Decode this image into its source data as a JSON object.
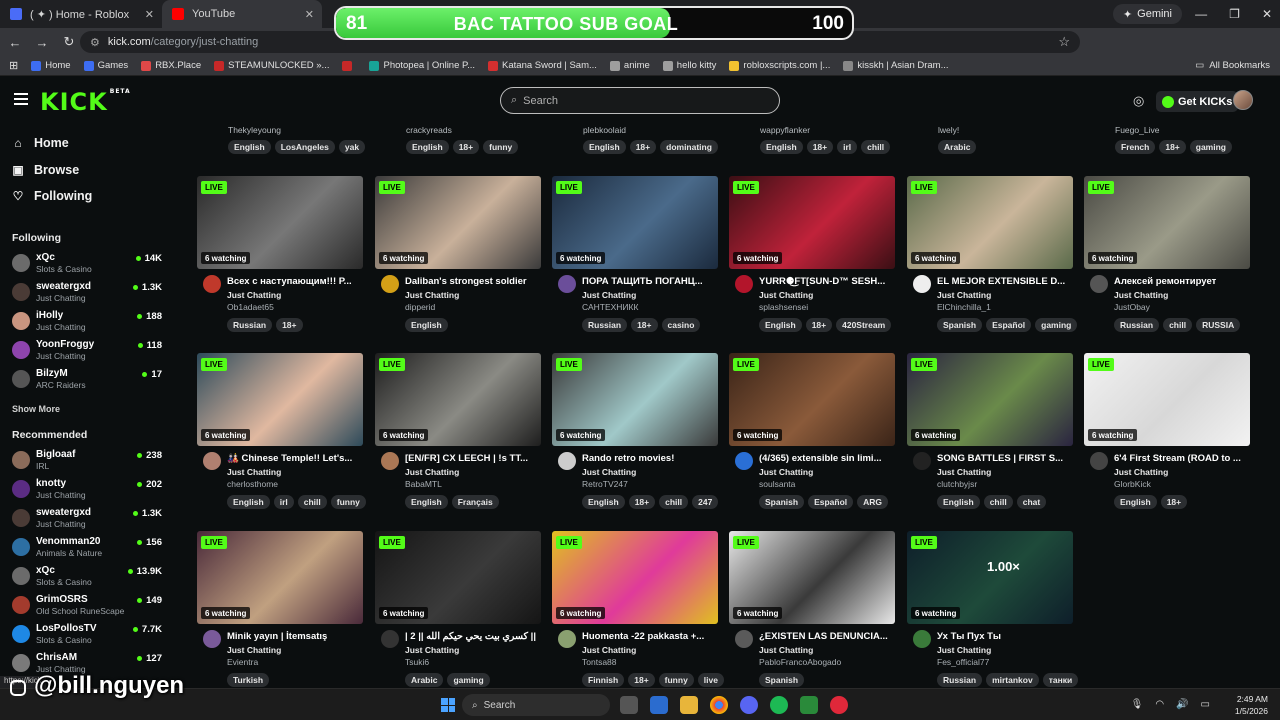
{
  "browser": {
    "tabs": [
      {
        "label": "( ✦ ) Home - Roblox",
        "favicon": "roblox-icon",
        "color": "#4a6cf7"
      },
      {
        "label": "YouTube",
        "favicon": "youtube-icon",
        "color": "#ff0000"
      }
    ],
    "gemini_label": "Gemini",
    "url_host": "kick.com",
    "url_path": "/category/just-chatting",
    "bookmarks": [
      {
        "label": "Home",
        "color": "#3d6df2"
      },
      {
        "label": "Games",
        "color": "#3d6df2"
      },
      {
        "label": "RBX.Place",
        "color": "#e04848"
      },
      {
        "label": "STEAMUNLOCKED »...",
        "color": "#c62828"
      },
      {
        "label": "",
        "color": "#c62828"
      },
      {
        "label": "Photopea | Online P...",
        "color": "#18a497"
      },
      {
        "label": "Katana Sword | Sam...",
        "color": "#d32f2f"
      },
      {
        "label": "anime",
        "color": "#9e9e9e"
      },
      {
        "label": "hello kitty",
        "color": "#9e9e9e"
      },
      {
        "label": "robloxscripts.com |...",
        "color": "#f2c230"
      },
      {
        "label": "kisskh | Asian Dram...",
        "color": "#888888"
      }
    ],
    "all_bookmarks": "All Bookmarks"
  },
  "goal": {
    "current": "81",
    "title": "BAC TATTOO SUB GOAL",
    "target": "100",
    "progress": 0.81
  },
  "header": {
    "logo": "KICK",
    "logo_badge": "BETA",
    "search_placeholder": "Search",
    "get_kicks": "Get KICKs"
  },
  "sidebar": {
    "nav": [
      {
        "label": "Home",
        "icon": "home-icon"
      },
      {
        "label": "Browse",
        "icon": "browse-icon"
      },
      {
        "label": "Following",
        "icon": "heart-icon"
      }
    ],
    "following_title": "Following",
    "following": [
      {
        "name": "xQc",
        "category": "Slots & Casino",
        "viewers": "14K",
        "color": "#6b6b6b"
      },
      {
        "name": "sweatergxd",
        "category": "Just Chatting",
        "viewers": "1.3K",
        "color": "#4a3b36"
      },
      {
        "name": "iHolly",
        "category": "Just Chatting",
        "viewers": "188",
        "color": "#c99580"
      },
      {
        "name": "YoonFroggy",
        "category": "Just Chatting",
        "viewers": "118",
        "color": "#8e44ad"
      },
      {
        "name": "BilzyM",
        "category": "ARC Raiders",
        "viewers": "17",
        "color": "#555555"
      }
    ],
    "show_more": "Show More",
    "recommended_title": "Recommended",
    "recommended": [
      {
        "name": "Bigloaaf",
        "category": "IRL",
        "viewers": "238",
        "color": "#8a6b5a"
      },
      {
        "name": "knotty",
        "category": "Just Chatting",
        "viewers": "202",
        "color": "#5b2c83"
      },
      {
        "name": "sweatergxd",
        "category": "Just Chatting",
        "viewers": "1.3K",
        "color": "#4a3b36"
      },
      {
        "name": "Venomman20",
        "category": "Animals & Nature",
        "viewers": "156",
        "color": "#2d6fa3"
      },
      {
        "name": "xQc",
        "category": "Slots & Casino",
        "viewers": "13.9K",
        "color": "#6b6b6b"
      },
      {
        "name": "GrimOSRS",
        "category": "Old School RuneScape",
        "viewers": "149",
        "color": "#a33b2d"
      },
      {
        "name": "LosPollosTV",
        "category": "Slots & Casino",
        "viewers": "7.7K",
        "color": "#1e88e5"
      },
      {
        "name": "ChrisAM",
        "category": "Just Chatting",
        "viewers": "127",
        "color": "#7a7a7a"
      }
    ]
  },
  "top_partial": [
    {
      "owner": "Thekyleyoung",
      "tags": [
        "English",
        "LosAngeles",
        "yak"
      ]
    },
    {
      "owner": "crackyreads",
      "tags": [
        "English",
        "18+",
        "funny"
      ]
    },
    {
      "owner": "plebkoolaid",
      "tags": [
        "English",
        "18+",
        "dominating"
      ]
    },
    {
      "owner": "wappyflanker",
      "tags": [
        "English",
        "18+",
        "irl",
        "chill"
      ]
    },
    {
      "owner": "lwely!",
      "tags": [
        "Arabic"
      ]
    },
    {
      "owner": "Fuego_Live",
      "tags": [
        "French",
        "18+",
        "gaming"
      ]
    }
  ],
  "cards": [
    {
      "title": "Всех с наступающим!!! Р...",
      "category": "Just Chatting",
      "owner": "Ob1adaet65",
      "watching": "6 watching",
      "tags": [
        "Russian",
        "18+"
      ],
      "thumb": "#2a2a2a",
      "thumb2": "#777777",
      "avatar": "#c0392b"
    },
    {
      "title": "Daliban's strongest soldier",
      "category": "Just Chatting",
      "owner": "dipperid",
      "watching": "6 watching",
      "tags": [
        "English"
      ],
      "thumb": "#3b3b3b",
      "thumb2": "#c8b09a",
      "avatar": "#d4a017"
    },
    {
      "title": "ПОРА ТАЩИТЬ ПОГАНЦ...",
      "category": "Just Chatting",
      "owner": "САНТЕХНИКК",
      "watching": "6 watching",
      "tags": [
        "Russian",
        "18+",
        "casino"
      ],
      "thumb": "#1b2a3d",
      "thumb2": "#4a6a8a",
      "avatar": "#6b4e9a"
    },
    {
      "title": "YURR⚈͜FT[SUN-D™ SESH...",
      "category": "Just Chatting",
      "owner": "splashsensei",
      "watching": "6 watching",
      "tags": [
        "English",
        "18+",
        "420Stream"
      ],
      "thumb": "#3a0f14",
      "thumb2": "#c0223a",
      "avatar": "#b3152b"
    },
    {
      "title": "EL MEJOR EXTENSIBLE D...",
      "category": "Just Chatting",
      "owner": "ElChinchilla_1",
      "watching": "6 watching",
      "tags": [
        "Spanish",
        "Español",
        "gaming"
      ],
      "thumb": "#5a6a4a",
      "thumb2": "#c9b59a",
      "avatar": "#eeeeee"
    },
    {
      "title": "Алексей ремонтирует",
      "category": "Just Chatting",
      "owner": "JustObay",
      "watching": "6 watching",
      "tags": [
        "Russian",
        "chill",
        "RUSSIA"
      ],
      "thumb": "#4a4a44",
      "thumb2": "#9a9a88",
      "avatar": "#555555"
    },
    {
      "title": "🎎 Chinese Temple!! Let's...",
      "category": "Just Chatting",
      "owner": "cherlosthome",
      "watching": "6 watching",
      "tags": [
        "English",
        "irl",
        "chill",
        "funny"
      ],
      "thumb": "#2d4a5a",
      "thumb2": "#e0b8a0",
      "avatar": "#b08070"
    },
    {
      "title": "[EN/FR] CX LEECH | !s TT...",
      "category": "Just Chatting",
      "owner": "BabaMTL",
      "watching": "6 watching",
      "tags": [
        "English",
        "Français"
      ],
      "thumb": "#1e1e1e",
      "thumb2": "#8a8a84",
      "avatar": "#aa7755"
    },
    {
      "title": "Rando retro movies!",
      "category": "Just Chatting",
      "owner": "RetroTV247",
      "watching": "6 watching",
      "tags": [
        "English",
        "18+",
        "chill",
        "247"
      ],
      "thumb": "#3a3a3a",
      "thumb2": "#a0c8c8",
      "avatar": "#cccccc"
    },
    {
      "title": "(4/365) extensible sin limi...",
      "category": "Just Chatting",
      "owner": "soulsanta",
      "watching": "6 watching",
      "tags": [
        "Spanish",
        "Español",
        "ARG"
      ],
      "thumb": "#3a2418",
      "thumb2": "#8a5a3a",
      "avatar": "#2a6fd6"
    },
    {
      "title": "SONG BATTLES | FIRST S...",
      "category": "Just Chatting",
      "owner": "clutchbyjsr",
      "watching": "6 watching",
      "tags": [
        "English",
        "chill",
        "chat"
      ],
      "thumb": "#2a2440",
      "thumb2": "#6a8a4a",
      "avatar": "#222222"
    },
    {
      "title": "6'4 First Stream (ROAD to ...",
      "category": "Just Chatting",
      "owner": "GlorbKick",
      "watching": "6 watching",
      "tags": [
        "English",
        "18+"
      ],
      "thumb": "#f2f2f2",
      "thumb2": "#d8d8d8",
      "avatar": "#444444"
    },
    {
      "title": "Minik yayın | İtemsatış",
      "category": "Just Chatting",
      "owner": "Evientra",
      "watching": "6 watching",
      "tags": [
        "Turkish"
      ],
      "thumb": "#4a2a3a",
      "thumb2": "#c0a080",
      "avatar": "#7a5a9a"
    },
    {
      "title": "| 2 || كسري بيت يحي حيكم الله ||",
      "category": "Just Chatting",
      "owner": "Tsuki6",
      "watching": "6 watching",
      "tags": [
        "Arabic",
        "gaming"
      ],
      "thumb": "#151515",
      "thumb2": "#3a3a3a",
      "avatar": "#333333"
    },
    {
      "title": "Huomenta -22 pakkasta +...",
      "category": "Just Chatting",
      "owner": "Tontsa88",
      "watching": "6 watching",
      "tags": [
        "Finnish",
        "18+",
        "funny",
        "live"
      ],
      "thumb": "#e0c020",
      "thumb2": "#e03a9a",
      "avatar": "#8aa070"
    },
    {
      "title": "¿EXISTEN LAS DENUNCIA...",
      "category": "Just Chatting",
      "owner": "PabloFrancoAbogado",
      "watching": "6 watching",
      "tags": [
        "Spanish"
      ],
      "thumb": "#e8e8e8",
      "thumb2": "#3a3a3a",
      "avatar": "#5a5a5a"
    },
    {
      "title": "Ух Ты Пух Ты",
      "category": "Just Chatting",
      "owner": "Fes_official77",
      "watching": "6 watching",
      "tags": [
        "Russian",
        "mirtankov",
        "танки"
      ],
      "thumb": "#0e1e2a",
      "thumb2": "#1e4a3a",
      "avatar": "#3a7a3a",
      "multiplier": "1.00×"
    }
  ],
  "live_label": "LIVE",
  "watermark": "@bill.nguyen",
  "status_url": "https://kick",
  "taskbar": {
    "search": "Search",
    "time": "2:49 AM",
    "date": "1/5/2026"
  }
}
